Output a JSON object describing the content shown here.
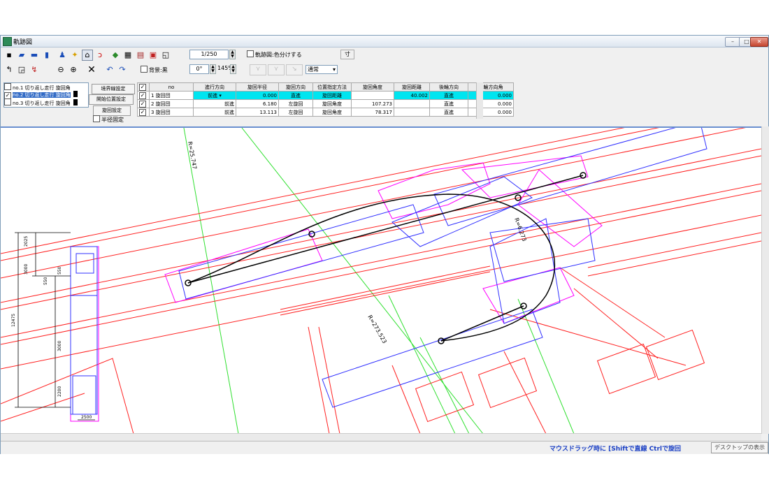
{
  "window": {
    "title": "軌跡図"
  },
  "toolbar": {
    "scale_value": "1/250",
    "color_option_label": "軌跡図:色分けする",
    "measure_label": "寸",
    "background_label": "背景:黒",
    "angle_value": "0°",
    "zoom_value": "145%",
    "mode_value": "通常"
  },
  "vehicles": [
    {
      "label": "no.1  切り返し走行 旋回角",
      "checked": false
    },
    {
      "label": "no.2  切り返し走行 旋回角",
      "checked": true
    },
    {
      "label": "no.3  切り返し走行 旋回角",
      "checked": false
    }
  ],
  "panel_buttons": {
    "boundary": "境界線設定",
    "start_pos": "開始位置設定",
    "turn_settings": "旋回設定",
    "radius_fix": "半径固定"
  },
  "grid": {
    "columns": [
      "no",
      "進行方向",
      "旋回半径",
      "旋回方向",
      "位置指定方法",
      "旋回角度",
      "旋回距離",
      "後輪方向",
      "後輪方向角"
    ],
    "rows": [
      {
        "no": "1 旋回団",
        "dir": "前進",
        "radius": "0.000",
        "turn": "直進",
        "method": "旋回距離",
        "angle": "",
        "dist": "40.002",
        "rear": "直進",
        "rear_angle": "0.000"
      },
      {
        "no": "2 旋回団",
        "dir": "前進",
        "radius": "6.180",
        "turn": "左旋回",
        "method": "旋回角度",
        "angle": "107.273",
        "dist": "",
        "rear": "直進",
        "rear_angle": "0.000"
      },
      {
        "no": "3 旋回団",
        "dir": "前進",
        "radius": "13.113",
        "turn": "左旋回",
        "method": "旋回角度",
        "angle": "78.317",
        "dist": "",
        "rear": "直進",
        "rear_angle": "0.000"
      }
    ]
  },
  "drawing": {
    "dim_labels": [
      "2025",
      "3000",
      "550",
      "550",
      "3000",
      "12475",
      "2200",
      "2500"
    ],
    "radius_label": "R=273.523",
    "top_label": "R=25.747",
    "side_label": "R=6.273",
    "colors": {
      "road": "#ff2020",
      "vehicle": "#3030ff",
      "envelope": "#ff00ff",
      "guide": "#30e030",
      "path": "#000000"
    }
  },
  "status": {
    "hint": "マウスドラッグ時に [Shiftで直線   Ctrlで旋回",
    "desktop": "デスクトップの表示"
  }
}
